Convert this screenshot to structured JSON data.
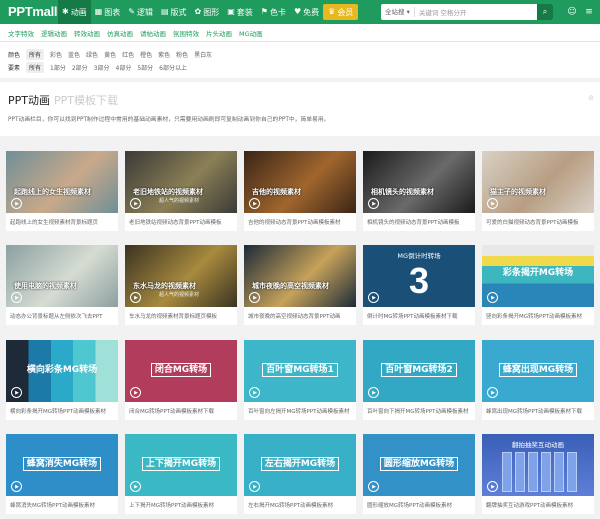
{
  "header": {
    "logo": "PPTmall",
    "nav": [
      {
        "icon": "star-icon",
        "glyph": "✱",
        "label": "动画",
        "active": true
      },
      {
        "icon": "chart-icon",
        "glyph": "▦",
        "label": "图表"
      },
      {
        "icon": "logic-icon",
        "glyph": "✎",
        "label": "逻辑"
      },
      {
        "icon": "layout-icon",
        "glyph": "▤",
        "label": "版式"
      },
      {
        "icon": "shape-icon",
        "glyph": "✿",
        "label": "图形"
      },
      {
        "icon": "package-icon",
        "glyph": "▣",
        "label": "套装"
      },
      {
        "icon": "palette-icon",
        "glyph": "⚑",
        "label": "色卡"
      },
      {
        "icon": "heart-icon",
        "glyph": "♥",
        "label": "免费"
      },
      {
        "icon": "crown-icon",
        "glyph": "♛",
        "label": "会员",
        "vip": true
      }
    ],
    "search": {
      "scope": "全站搜 ▾",
      "placeholder": "关键词 空格分开",
      "button": "⌕"
    },
    "user_icon": "☺",
    "menu_icon": "≡"
  },
  "subnav": [
    "文字特效",
    "逻辑动画",
    "转效动画",
    "仿真动画",
    "请帖动画",
    "氛围特效",
    "片头动画",
    "MG动画"
  ],
  "filters": {
    "color": {
      "label": "颜色",
      "options": [
        "所有",
        "彩色",
        "蓝色",
        "绿色",
        "黄色",
        "红色",
        "橙色",
        "紫色",
        "粉色",
        "黑白灰"
      ]
    },
    "element": {
      "label": "要素",
      "options": [
        "所有",
        "1部分",
        "2部分",
        "3部分",
        "4部分",
        "5部分",
        "6部分以上"
      ]
    }
  },
  "page": {
    "title": "PPT动画",
    "subtitle": "PPT模板下载",
    "desc": "PPT动画栏目，你可以找到PPT制作过程中常用的基础动画素材，只需要用动画刷即可复制动画到你自己的PPT中，简单易用。",
    "rss": "⊘"
  },
  "cards": [
    {
      "title": "起跑线上的女生视频素材",
      "tsub": "",
      "caption": "起跑线上的女生视频素材背景标题页",
      "bg": "#6f8f96",
      "type": "photo",
      "accent": "#c9a98a"
    },
    {
      "title": "老旧地铁站的视频素材",
      "tsub": "超人气的视频素材",
      "caption": "老旧地铁站视频动态背景PPT动画模板",
      "bg": "#3a3a38",
      "type": "photo",
      "accent": "#8a7f55"
    },
    {
      "title": "吉他的视频素材",
      "tsub": "",
      "caption": "吉他的视频动态背景PPT动画模板素材",
      "bg": "#3a2416",
      "type": "photo",
      "accent": "#a0662e"
    },
    {
      "title": "相机镜头的视频素材",
      "tsub": "",
      "caption": "相机镜头的视频动态背景PPT动画模板",
      "bg": "#1a1a1a",
      "type": "photo",
      "accent": "#6a6a6a"
    },
    {
      "title": "猫主子的视频素材",
      "tsub": "",
      "caption": "可爱的白猫视频动态背景PPT动画模板",
      "bg": "#d8d2c6",
      "type": "photo",
      "accent": "#b89d82"
    },
    {
      "title": "使用电脑的视频素材",
      "tsub": "",
      "caption": "动态办公背景标题从左侧依次飞去PPT",
      "bg": "#8ba0a0",
      "type": "photo",
      "accent": "#d6dcd2"
    },
    {
      "title": "东水马龙的视频素材",
      "tsub": "超人气的视频素材",
      "caption": "车水马龙的视频素材背景标题页模板",
      "bg": "#3a3322",
      "type": "photo",
      "accent": "#a88a3e"
    },
    {
      "title": "城市夜晚的高空视频素材",
      "tsub": "",
      "caption": "城市夜晚的高空视频动态背景PPT动画",
      "bg": "#1c2a38",
      "type": "photo",
      "accent": "#c7a25a"
    },
    {
      "title": "MG倒计时转场",
      "tsub": "",
      "caption": "倒计时MG转场PPT动画模板素材下载",
      "bg": "#1a4f78",
      "type": "countdown",
      "accent": "#1a4f78",
      "big": "3"
    },
    {
      "title": "彩条揭开MG转场",
      "tsub": "",
      "caption": "竖向彩条揭开MG转场PPT动画模板素材",
      "bg": "#3cb6bf",
      "type": "stripes",
      "accent": "#f0d94a"
    },
    {
      "title": "横向彩条MG转场",
      "tsub": "",
      "caption": "横向彩条揭开MG转场PPT动画模板素材",
      "bg": "#1e2a38",
      "type": "vstripes",
      "accent": "#2aa9c8"
    },
    {
      "title": "闭合MG转场",
      "tsub": "",
      "caption": "闭合MG转场PPT动画模板素材下载",
      "bg": "#b23c5c",
      "type": "mg",
      "accent": "#b23c5c"
    },
    {
      "title": "百叶窗MG转场1",
      "tsub": "",
      "caption": "百叶窗向左揭开MG转场PPT动画模板素材",
      "bg": "#3cb6c8",
      "type": "mg",
      "accent": "#3cb6c8"
    },
    {
      "title": "百叶窗MG转场2",
      "tsub": "",
      "caption": "百叶窗向下揭开MG转场PPT动画模板素材",
      "bg": "#32a8c4",
      "type": "mg",
      "accent": "#32a8c4"
    },
    {
      "title": "蜂窝出现MG转场",
      "tsub": "",
      "caption": "蜂窝出现MG转场PPT动画模板素材下载",
      "bg": "#3aa9d0",
      "type": "mg",
      "accent": "#3aa9d0"
    },
    {
      "title": "蜂窝消失MG转场",
      "tsub": "",
      "caption": "蜂窝消失MG转场PPT动画模板素材",
      "bg": "#2e8fc8",
      "type": "mg",
      "accent": "#2e8fc8"
    },
    {
      "title": "上下揭开MG转场",
      "tsub": "",
      "caption": "上下揭开MG转场PPT动画模板素材",
      "bg": "#3ab8c4",
      "type": "mg",
      "accent": "#3ab8c4"
    },
    {
      "title": "左右揭开MG转场",
      "tsub": "",
      "caption": "左右揭开MG转场PPT动画模板素材",
      "bg": "#38b0c8",
      "type": "mg",
      "accent": "#38b0c8"
    },
    {
      "title": "圆形缩放MG转场",
      "tsub": "",
      "caption": "圆形缩放MG转场PPT动画模板素材",
      "bg": "#3292c8",
      "type": "mg",
      "accent": "#3292c8"
    },
    {
      "title": "翻拍抽奖互动动画",
      "tsub": "",
      "caption": "翻牌抽奖互动游戏PPT动画模板素材",
      "bg": "#3a5fb8",
      "type": "cards",
      "accent": "#5e7fd6"
    }
  ]
}
